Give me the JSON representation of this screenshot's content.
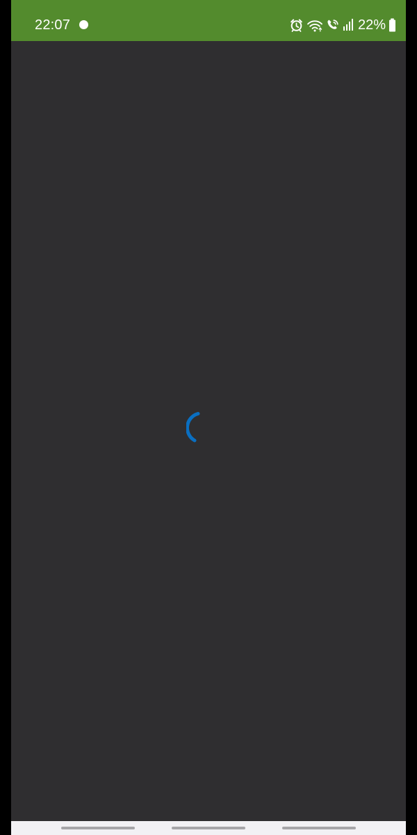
{
  "status_bar": {
    "time": "22:07",
    "battery": "22%",
    "background_color": "#538B2D",
    "icons": [
      "notification-dot-icon",
      "alarm-icon",
      "wifi-icon",
      "wifi-calling-icon",
      "signal-icon",
      "battery-icon"
    ]
  },
  "content": {
    "background_color": "#2F2E30",
    "loading_spinner_color": "#0A6FC1"
  },
  "navigation_bar": {
    "background_color": "#F2F1F4",
    "handles": [
      "left-handle",
      "center-handle",
      "right-handle"
    ]
  }
}
